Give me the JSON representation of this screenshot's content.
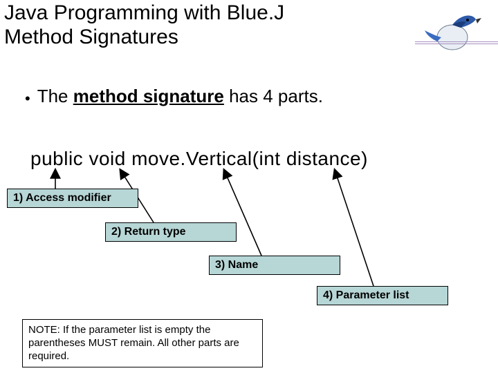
{
  "title": {
    "line1": "Java Programming with Blue.J",
    "line2": "Method Signatures"
  },
  "bullet": {
    "prefix": "The ",
    "term": "method signature",
    "suffix": " has 4 parts."
  },
  "code": "public void move.Vertical(int distance)",
  "labels": {
    "l1": "1)  Access modifier",
    "l2": "2)  Return type",
    "l3": "3)  Name",
    "l4": "4)  Parameter list"
  },
  "note": "NOTE: If the parameter list is empty the parentheses MUST remain.  All other parts are required.",
  "icons": {
    "logo": "bluej-jay-icon"
  },
  "colors": {
    "label_bg": "#b7d6d6",
    "rule": "#a48fbf"
  }
}
